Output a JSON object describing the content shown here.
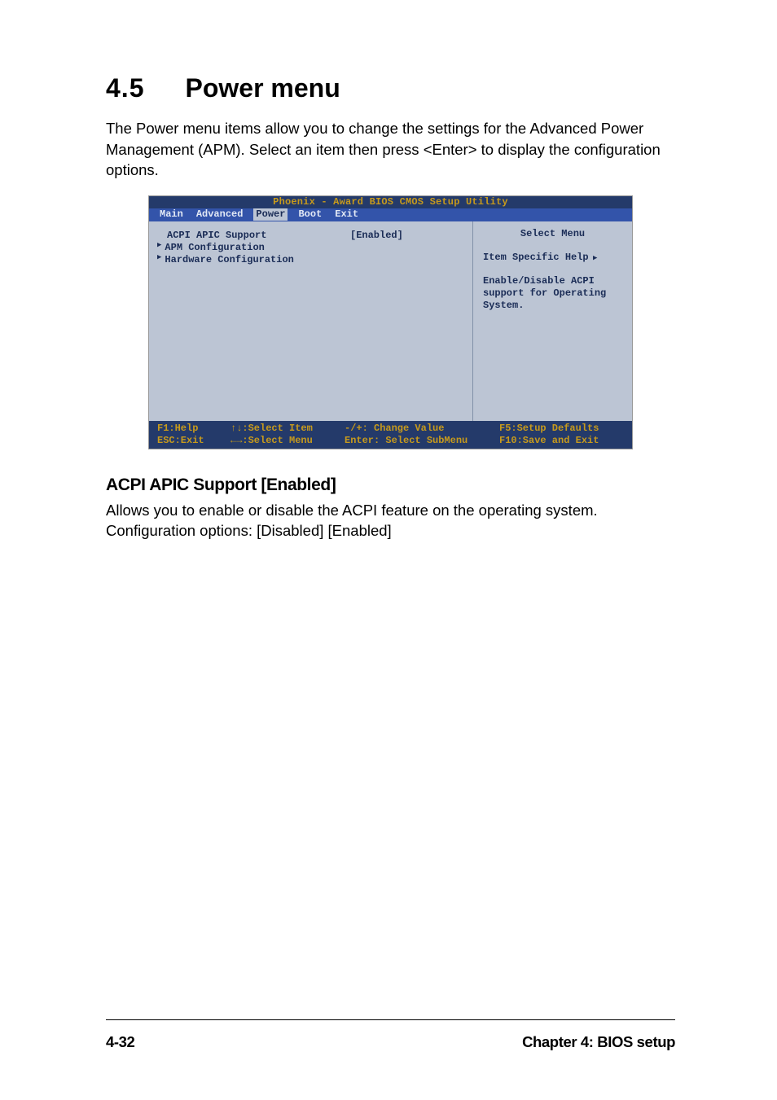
{
  "section": {
    "number": "4.5",
    "title": "Power menu"
  },
  "intro": "The Power menu items allow you to change the settings for the Advanced Power Management (APM). Select an item then press <Enter> to display the configuration options.",
  "bios": {
    "title": "Phoenix - Award BIOS CMOS Setup Utility",
    "tabs": [
      "Main",
      "Advanced",
      "Power",
      "Boot",
      "Exit"
    ],
    "activeTab": "Power",
    "leftItems": [
      {
        "label": "ACPI APIC Support",
        "value": "[Enabled]",
        "submenu": false
      },
      {
        "label": "APM Configuration",
        "value": "",
        "submenu": true
      },
      {
        "label": "Hardware Configuration",
        "value": "",
        "submenu": true
      }
    ],
    "right": {
      "title": "Select Menu",
      "helpItem": "Item Specific Help",
      "helpText": "Enable/Disable ACPI support for Operating System."
    },
    "footer": {
      "c1a": "F1:Help",
      "c1b": "ESC:Exit",
      "c2a": "↑↓:Select Item",
      "c2b": "←→:Select Menu",
      "c3a": "-/+: Change Value",
      "c3b": "Enter: Select SubMenu",
      "c4a": "F5:Setup Defaults",
      "c4b": "F10:Save and Exit"
    }
  },
  "sub": {
    "heading": "ACPI APIC Support [Enabled]",
    "body": "Allows you to enable or disable the ACPI feature on the operating system. Configuration options: [Disabled] [Enabled]"
  },
  "footer": {
    "pageNum": "4-32",
    "chapter": "Chapter 4: BIOS setup"
  }
}
